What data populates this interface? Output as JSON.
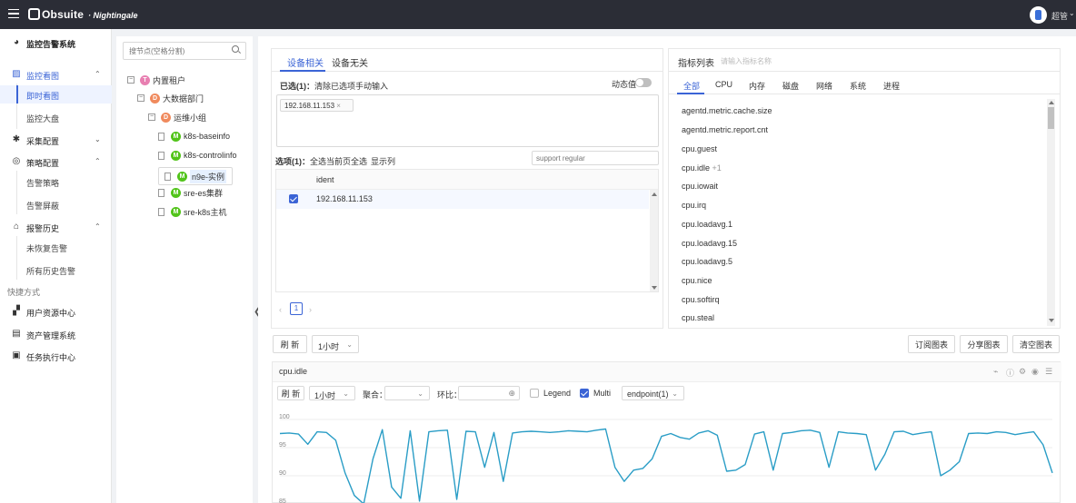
{
  "topbar": {
    "brand": "Obsuite",
    "product": "Nightingale",
    "user": "超管"
  },
  "sidebar": {
    "system": "监控告警系统",
    "groups": [
      {
        "label": "监控看图",
        "items": [
          "即时看图",
          "监控大盘"
        ]
      },
      {
        "label": "采集配置"
      },
      {
        "label": "策略配置",
        "items": [
          "告警策略",
          "告警屏蔽"
        ]
      },
      {
        "label": "报警历史",
        "items": [
          "未恢复告警",
          "所有历史告警"
        ]
      }
    ],
    "shortcut_title": "快捷方式",
    "shortcuts": [
      "用户资源中心",
      "资产管理系统",
      "任务执行中心"
    ]
  },
  "tree": {
    "search_placeholder": "搜节点(空格分割)",
    "nodes": [
      {
        "badge": "T",
        "label": "内置租户"
      },
      {
        "badge": "D",
        "label": "大数据部门"
      },
      {
        "badge": "D",
        "label": "运维小组"
      },
      {
        "badge": "M",
        "label": "k8s-baseinfo"
      },
      {
        "badge": "M",
        "label": "k8s-controlinfo"
      },
      {
        "badge": "M",
        "label": "n9e-实例"
      },
      {
        "badge": "M",
        "label": "sre-es集群"
      },
      {
        "badge": "M",
        "label": "sre-k8s主机"
      }
    ]
  },
  "device": {
    "tabs": [
      "设备相关",
      "设备无关"
    ],
    "selected_title": "已选(1)：",
    "clear_link": "清除已选项",
    "manual_link": "手动输入",
    "dynamic_label": "动态值",
    "selected_tags": [
      "192.168.11.153"
    ],
    "options_title": "选项(1)：",
    "select_page_link": "全选当前页",
    "select_all_link": "全选",
    "show_column_link": "显示列",
    "filter_placeholder": "support regular",
    "column_header": "ident",
    "rows": [
      "192.168.11.153"
    ],
    "page": "1"
  },
  "metrics": {
    "title": "指标列表",
    "search_placeholder": "请输入指标名称",
    "tabs": [
      "全部",
      "CPU",
      "内存",
      "磁盘",
      "网络",
      "系统",
      "进程"
    ],
    "items": [
      {
        "name": "agentd.metric.cache.size",
        "extra": ""
      },
      {
        "name": "agentd.metric.report.cnt",
        "extra": ""
      },
      {
        "name": "cpu.guest",
        "extra": ""
      },
      {
        "name": "cpu.idle",
        "extra": "+1"
      },
      {
        "name": "cpu.iowait",
        "extra": ""
      },
      {
        "name": "cpu.irq",
        "extra": ""
      },
      {
        "name": "cpu.loadavg.1",
        "extra": ""
      },
      {
        "name": "cpu.loadavg.15",
        "extra": ""
      },
      {
        "name": "cpu.loadavg.5",
        "extra": ""
      },
      {
        "name": "cpu.nice",
        "extra": ""
      },
      {
        "name": "cpu.softirq",
        "extra": ""
      },
      {
        "name": "cpu.steal",
        "extra": ""
      }
    ]
  },
  "toolbar": {
    "refresh": "刷 新",
    "range": "1小时",
    "subscribe": "订阅图表",
    "share": "分享图表",
    "clear": "清空图表"
  },
  "chart_card": {
    "title": "cpu.idle",
    "refresh": "刷 新",
    "range": "1小时",
    "aggr_label": "聚合：",
    "compare_label": "环比：",
    "legend_label": "Legend",
    "multi_label": "Multi",
    "endpoint_select": "endpoint(1)"
  },
  "colors": {
    "accent": "#3b64d6",
    "line": "#2a9dc6",
    "topbar": "#2b2d36"
  },
  "chart_data": {
    "type": "line",
    "y_ticks": [
      "100",
      "95",
      "90",
      "85"
    ],
    "ylim": [
      85,
      100
    ],
    "grid": true,
    "series": [
      {
        "values": [
          97.5,
          97.6,
          97.4,
          95.6,
          97.8,
          97.7,
          96.3,
          90.5,
          86.5,
          85,
          93,
          98.2,
          88,
          86,
          98,
          85.5,
          97.8,
          98,
          98.1,
          85.8,
          97.9,
          97.8,
          91.5,
          97.7,
          89,
          97.6,
          97.8,
          97.9,
          97.8,
          97.7,
          97.8,
          98,
          97.9,
          97.8,
          98.1,
          98.3,
          91.5,
          89,
          91,
          91.3,
          93,
          97,
          97.5,
          96.8,
          96.5,
          97.6,
          98,
          97.2,
          90.8,
          91,
          92,
          97.4,
          97.8,
          91,
          97.5,
          97.7,
          98,
          98.1,
          97.7,
          91.5,
          97.8,
          97.6,
          97.5,
          97.3,
          91,
          93.8,
          97.8,
          97.9,
          97.3,
          97.6,
          97.8,
          90,
          91,
          92.5,
          97.5,
          97.6,
          97.5,
          97.8,
          97.7,
          97.3,
          97.6,
          97.8,
          95.5,
          90.5
        ]
      }
    ]
  }
}
